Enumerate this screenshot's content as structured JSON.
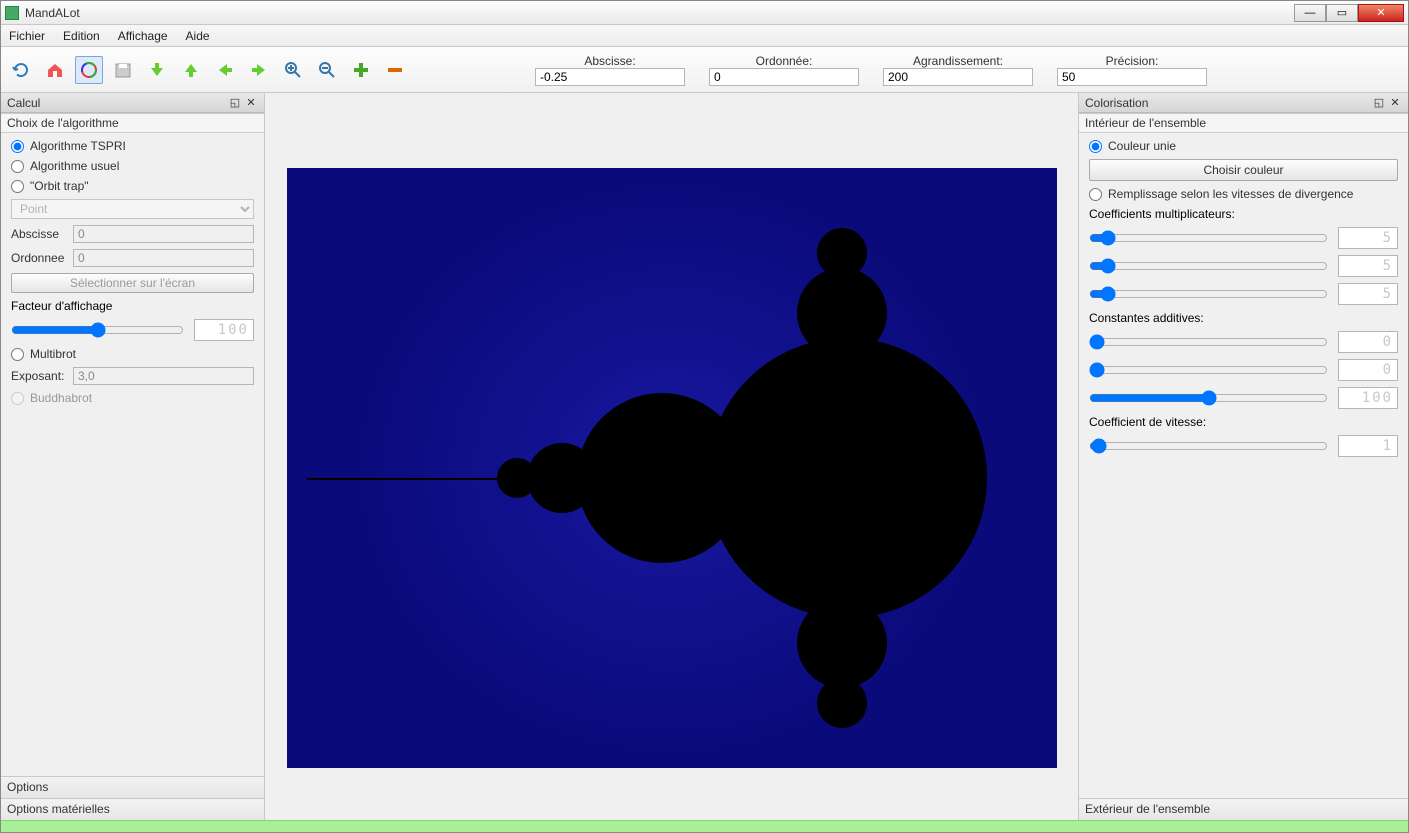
{
  "window": {
    "title": "MandALot"
  },
  "menu": {
    "file": "Fichier",
    "edit": "Edition",
    "view": "Affichage",
    "help": "Aide"
  },
  "toolbar_labels": {
    "abscisse": "Abscisse:",
    "ordonnee": "Ordonnée:",
    "zoom": "Agrandissement:",
    "precision": "Précision:"
  },
  "toolbar_values": {
    "abscisse": "-0.25",
    "ordonnee": "0",
    "zoom": "200",
    "precision": "50"
  },
  "left_panel": {
    "title": "Calcul",
    "section": "Choix de l'algorithme",
    "algo_tspri": "Algorithme TSPRI",
    "algo_usuel": "Algorithme usuel",
    "algo_orbit": "\"Orbit trap\"",
    "orbit_type": "Point",
    "abscisse_lbl": "Abscisse",
    "abscisse_val": "0",
    "ordonnee_lbl": "Ordonnee",
    "ordonnee_val": "0",
    "select_btn": "Sélectionner sur l'écran",
    "facteur_lbl": "Facteur d'affichage",
    "facteur_val": "100",
    "multibrot": "Multibrot",
    "exposant_lbl": "Exposant:",
    "exposant_val": "3,0",
    "buddhabrot": "Buddhabrot",
    "tab_options": "Options",
    "tab_hw": "Options matérielles"
  },
  "right_panel": {
    "title": "Colorisation",
    "section_int": "Intérieur de l'ensemble",
    "couleur_unie": "Couleur unie",
    "choisir_btn": "Choisir couleur",
    "remplissage": "Remplissage selon les vitesses de divergence",
    "coef_mult": "Coefficients multiplicateurs:",
    "const_add": "Constantes additives:",
    "coef_vit": "Coefficient de vitesse:",
    "v5": "5",
    "v0": "0",
    "v100": "100",
    "v1": "1",
    "section_ext": "Extérieur de l'ensemble"
  }
}
